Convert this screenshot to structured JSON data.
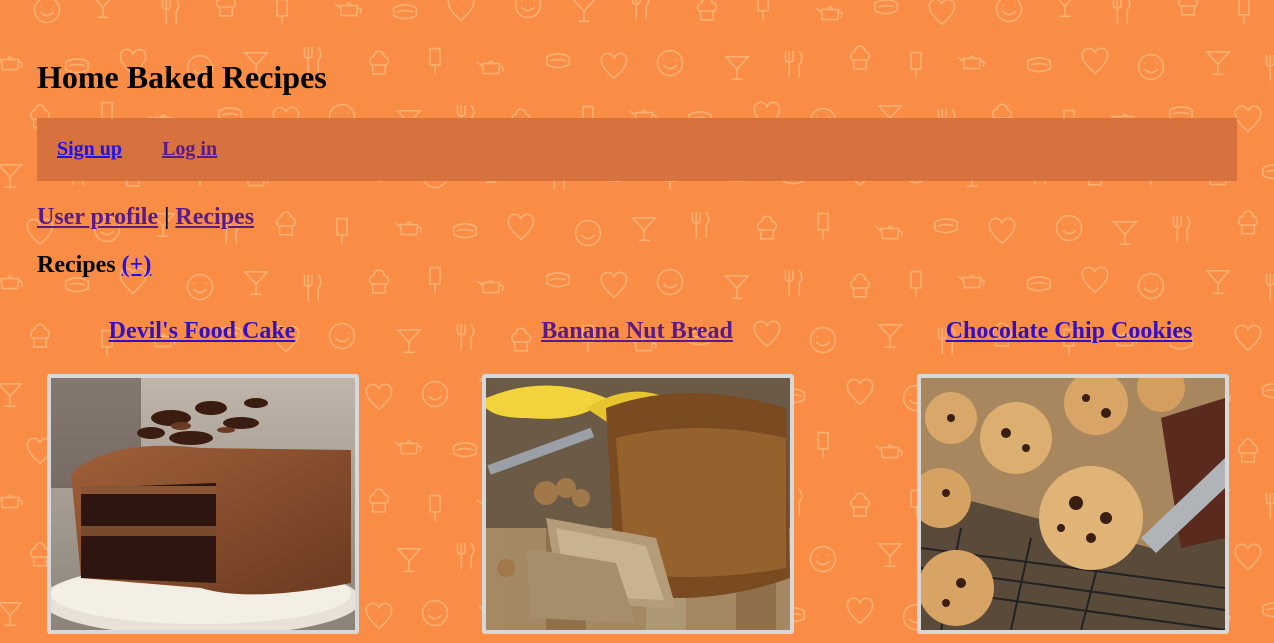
{
  "site": {
    "title": "Home Baked Recipes"
  },
  "topnav": {
    "signup_label": "Sign up",
    "login_label": "Log in"
  },
  "breadcrumb": {
    "profile_label": "User profile",
    "separator": "|",
    "recipes_label": "Recipes"
  },
  "recipes_section": {
    "heading": "Recipes",
    "add_label": "(+)"
  },
  "recipes": [
    {
      "name": "Devil's Food Cake",
      "image_icon": "chocolate-cake-photo"
    },
    {
      "name": "Banana Nut Bread",
      "image_icon": "banana-bread-photo"
    },
    {
      "name": "Chocolate Chip Cookies",
      "image_icon": "cookies-photo"
    }
  ],
  "colors": {
    "background": "#f98d45",
    "nav_bar": "#d7723e",
    "link": "#1f12ee",
    "visited_link": "#5a1a8a"
  }
}
